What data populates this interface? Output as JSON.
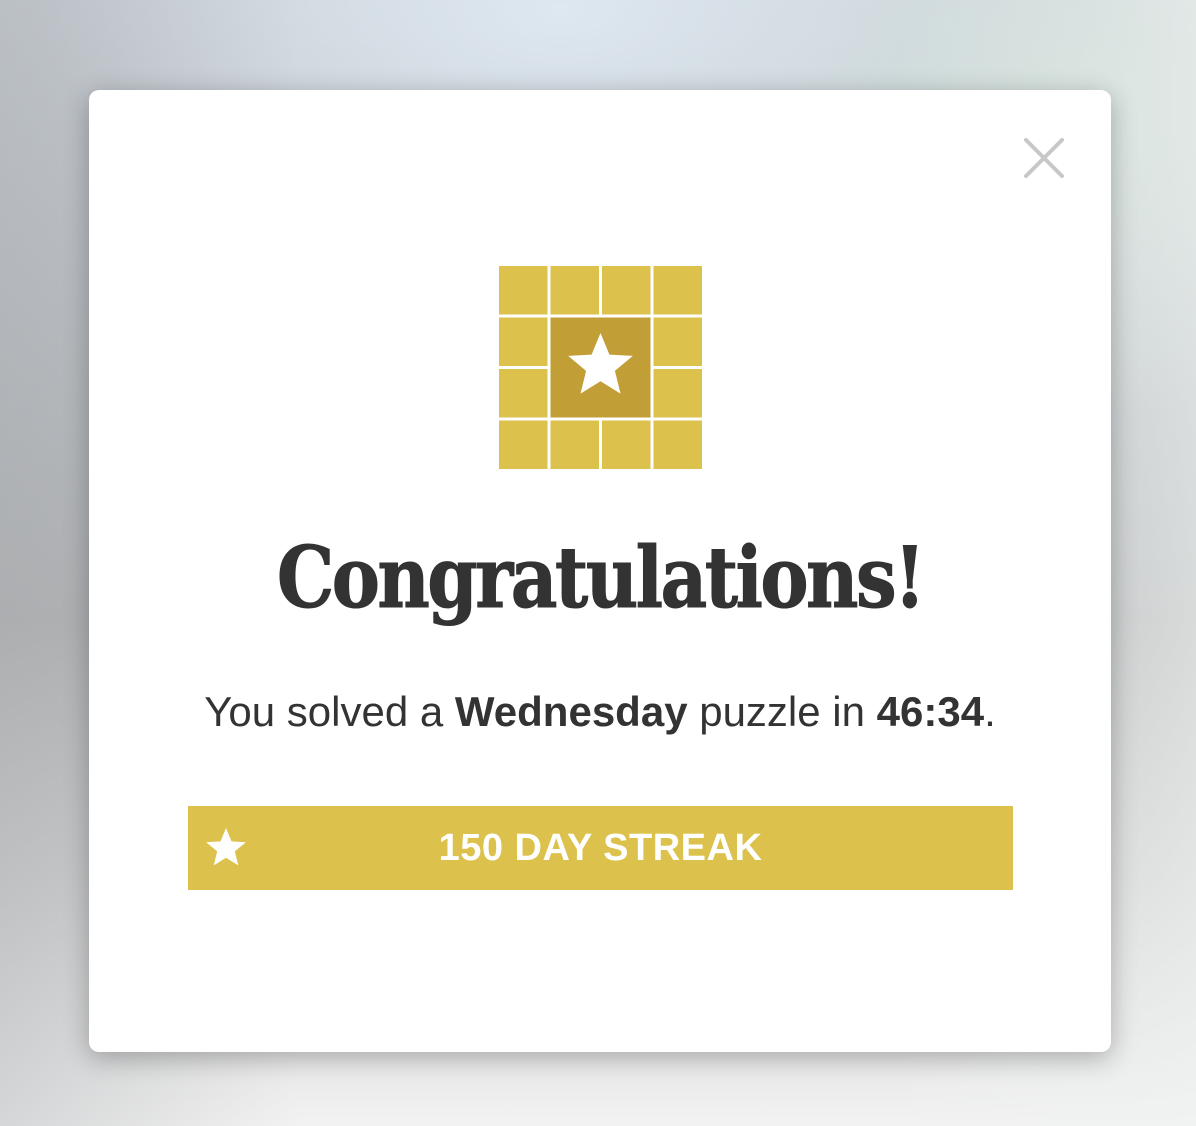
{
  "dialog": {
    "title": "Congratulations!",
    "message": {
      "prefix": "You solved a ",
      "day": "Wednesday",
      "middle": " puzzle in ",
      "time": "46:34",
      "suffix": "."
    },
    "streak": {
      "label": "150 DAY STREAK",
      "icon": "star-icon"
    },
    "close_icon": "close-icon",
    "badge_icon": "gold-star-grid-icon"
  },
  "colors": {
    "gold": "#dcc24c",
    "gold_dark": "#c29f36",
    "text": "#333333",
    "close": "#c7c7c7"
  }
}
